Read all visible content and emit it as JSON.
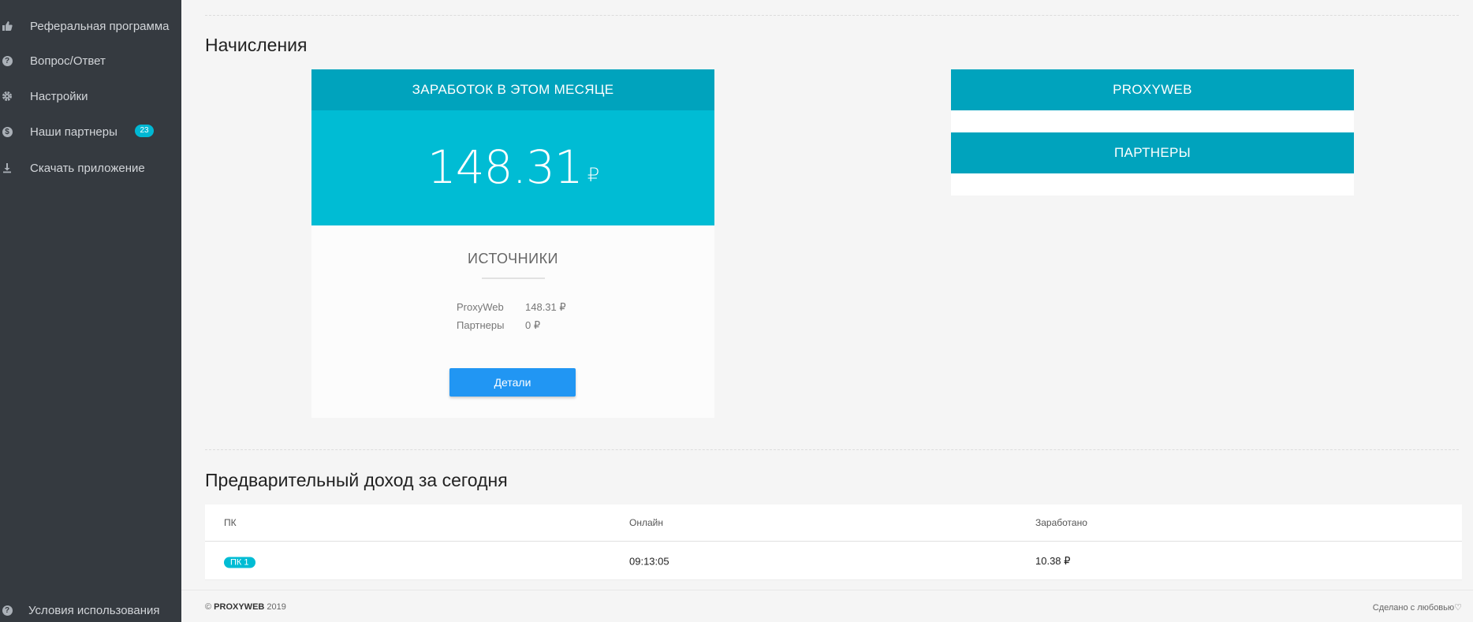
{
  "sidebar": {
    "items": [
      {
        "label": "Реферальная программа",
        "icon": "thumbs-up-icon"
      },
      {
        "label": "Вопрос/Ответ",
        "icon": "question-circle-icon"
      },
      {
        "label": "Настройки",
        "icon": "gear-icon"
      },
      {
        "label": "Наши партнеры",
        "icon": "dollar-circle-icon",
        "badge": "23"
      },
      {
        "label": "Скачать приложение",
        "icon": "download-icon"
      }
    ],
    "bottom": {
      "label": "Условия использования",
      "icon": "question-circle-icon"
    }
  },
  "accruals": {
    "title": "Начисления",
    "card": {
      "header": "ЗАРАБОТОК В ЭТОМ МЕСЯЦЕ",
      "amount": "148.31",
      "currency": "₽",
      "sources_title": "ИСТОЧНИКИ",
      "sources": [
        {
          "name": "ProxyWeb",
          "value": "148.31 ₽"
        },
        {
          "name": "Партнеры",
          "value": "0 ₽"
        }
      ],
      "details_label": "Детали"
    },
    "panel": {
      "tabs": [
        "PROXYWEB",
        "ПАРТНЕРЫ"
      ]
    }
  },
  "today": {
    "title": "Предварительный доход за сегодня",
    "columns": [
      "ПК",
      "Онлайн",
      "Заработано"
    ],
    "rows": [
      {
        "pc": "ПК 1",
        "online": "09:13:05",
        "earned": "10.38 ₽"
      }
    ]
  },
  "footer": {
    "copyright": "©",
    "brand": "PROXYWEB",
    "year": "2019",
    "made_with": "Сделано с любовью♡"
  },
  "colors": {
    "sidebar_bg": "#353a40",
    "accent": "#00bcd4",
    "accent_dark": "#00a3bd",
    "button": "#2196f3"
  }
}
